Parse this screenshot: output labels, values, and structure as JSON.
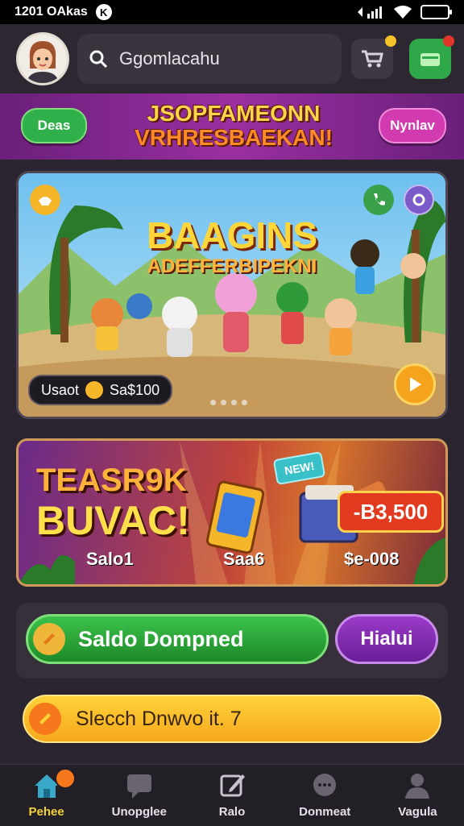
{
  "status_bar": {
    "time": "1201 OAkas",
    "circle_glyph": "K"
  },
  "header": {
    "search_text": "Ggomlacahu",
    "accent": "#2fa84a"
  },
  "promo": {
    "left_pill": "Deas",
    "title_line1": "JSOPFAMEONN",
    "title_line2": "VRHRESBAEKAN!",
    "right_pill": "Nynlav"
  },
  "hero": {
    "title_line1": "BAAGINS",
    "title_line2": "ADEFFERBIPEKNI",
    "pill_label": "Usaot",
    "pill_value": "Sa$100"
  },
  "deal": {
    "title_line1": "TEASR9K",
    "title_line2": "BUVAC!",
    "badge_text": "NEW!",
    "price": "-B3,500",
    "label_1": "Salo1",
    "label_2": "Saa6",
    "label_3": "$e-008"
  },
  "actions": {
    "primary": "Saldo Dompned",
    "secondary": "Hialui",
    "tertiary": "Slecch Dnwvo it. 7"
  },
  "nav": {
    "items": [
      {
        "label": "Pehee",
        "icon": "home-icon"
      },
      {
        "label": "Unopglee",
        "icon": "chat-icon"
      },
      {
        "label": "Ralo",
        "icon": "edit-icon"
      },
      {
        "label": "Donmeat",
        "icon": "support-icon"
      },
      {
        "label": "Vagula",
        "icon": "user-icon"
      }
    ]
  }
}
